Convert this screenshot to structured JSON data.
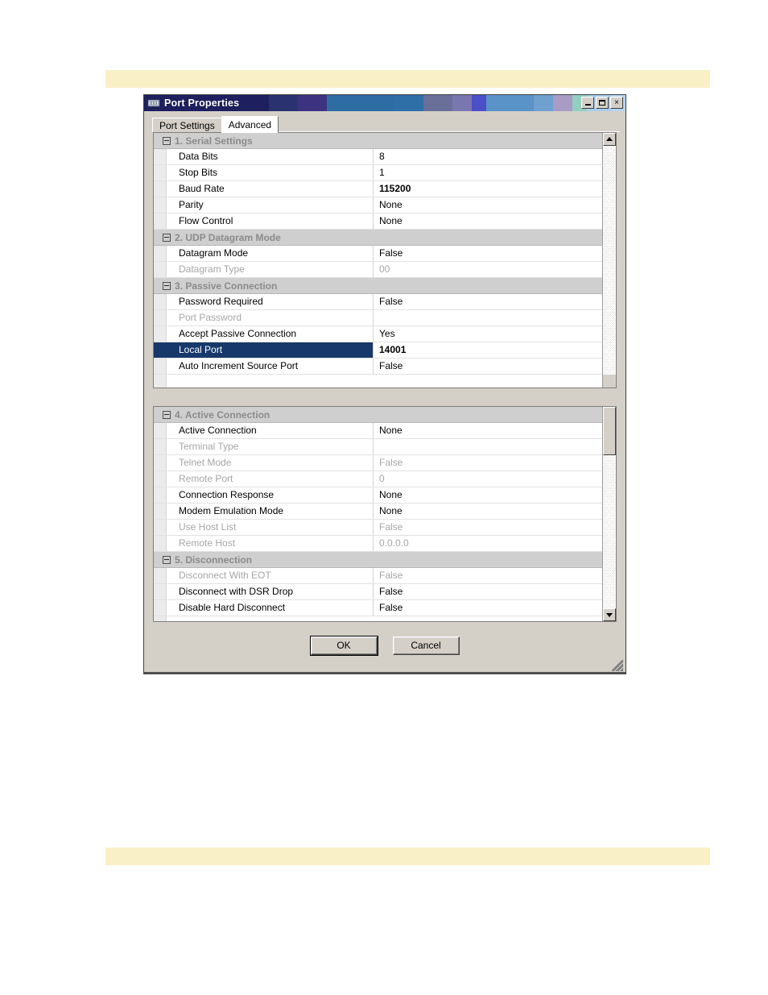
{
  "window": {
    "title": "Port Properties",
    "icon": "serial-port-icon",
    "titlebar_bands": [
      "#1d1f5e",
      "#2a3270",
      "#3d3280",
      "#2e6da4",
      "#2f6fa8",
      "#6a6f9a",
      "#7a77b0",
      "#4b4fc8",
      "#5a93c8",
      "#6fa0d0",
      "#a89cc4",
      "#93cfc0",
      "#a8cdee",
      "#b5d6f2"
    ],
    "controls": {
      "minimize": "minimize-button",
      "maximize": "maximize-button",
      "close": "×"
    }
  },
  "tabs": [
    {
      "label": "Port Settings",
      "selected": false
    },
    {
      "label": "Advanced",
      "selected": true
    }
  ],
  "panels": [
    {
      "name": "upper-grid",
      "scroll": {
        "thumb_visible": false,
        "up_arrow": true,
        "down_arrow": false
      },
      "rows": [
        {
          "type": "header",
          "label": "1. Serial Settings"
        },
        {
          "type": "prop",
          "name": "Data Bits",
          "value": "8",
          "disabled": false,
          "bold": false,
          "selected": false
        },
        {
          "type": "prop",
          "name": "Stop Bits",
          "value": "1",
          "disabled": false,
          "bold": false,
          "selected": false
        },
        {
          "type": "prop",
          "name": "Baud Rate",
          "value": "115200",
          "disabled": false,
          "bold": true,
          "selected": false
        },
        {
          "type": "prop",
          "name": "Parity",
          "value": "None",
          "disabled": false,
          "bold": false,
          "selected": false
        },
        {
          "type": "prop",
          "name": "Flow Control",
          "value": "None",
          "disabled": false,
          "bold": false,
          "selected": false
        },
        {
          "type": "header",
          "label": "2. UDP Datagram Mode"
        },
        {
          "type": "prop",
          "name": "Datagram Mode",
          "value": "False",
          "disabled": false,
          "bold": false,
          "selected": false
        },
        {
          "type": "prop",
          "name": "Datagram Type",
          "value": "00",
          "disabled": true,
          "bold": false,
          "selected": false
        },
        {
          "type": "header",
          "label": "3. Passive Connection"
        },
        {
          "type": "prop",
          "name": "Password Required",
          "value": "False",
          "disabled": false,
          "bold": false,
          "selected": false
        },
        {
          "type": "prop",
          "name": "Port Password",
          "value": "",
          "disabled": true,
          "bold": false,
          "selected": false
        },
        {
          "type": "prop",
          "name": "Accept Passive Connection",
          "value": "Yes",
          "disabled": false,
          "bold": false,
          "selected": false
        },
        {
          "type": "prop",
          "name": "Local Port",
          "value": "14001",
          "disabled": false,
          "bold": true,
          "selected": true
        },
        {
          "type": "prop",
          "name": "Auto Increment Source Port",
          "value": "False",
          "disabled": false,
          "bold": false,
          "selected": false
        }
      ]
    },
    {
      "name": "lower-grid",
      "scroll": {
        "thumb_visible": true,
        "up_arrow": false,
        "down_arrow": true
      },
      "rows": [
        {
          "type": "header",
          "label": "4. Active Connection"
        },
        {
          "type": "prop",
          "name": "Active Connection",
          "value": "None",
          "disabled": false,
          "bold": false,
          "selected": false
        },
        {
          "type": "prop",
          "name": "Terminal Type",
          "value": "",
          "disabled": true,
          "bold": false,
          "selected": false
        },
        {
          "type": "prop",
          "name": "Telnet Mode",
          "value": "False",
          "disabled": true,
          "bold": false,
          "selected": false
        },
        {
          "type": "prop",
          "name": "Remote Port",
          "value": "0",
          "disabled": true,
          "bold": false,
          "selected": false
        },
        {
          "type": "prop",
          "name": "Connection Response",
          "value": "None",
          "disabled": false,
          "bold": false,
          "selected": false
        },
        {
          "type": "prop",
          "name": "Modem Emulation Mode",
          "value": "None",
          "disabled": false,
          "bold": false,
          "selected": false
        },
        {
          "type": "prop",
          "name": "Use Host List",
          "value": "False",
          "disabled": true,
          "bold": false,
          "selected": false
        },
        {
          "type": "prop",
          "name": "Remote Host",
          "value": "0.0.0.0",
          "disabled": true,
          "bold": false,
          "selected": false
        },
        {
          "type": "header",
          "label": "5. Disconnection"
        },
        {
          "type": "prop",
          "name": "Disconnect With EOT",
          "value": "False",
          "disabled": true,
          "bold": false,
          "selected": false
        },
        {
          "type": "prop",
          "name": "Disconnect with DSR Drop",
          "value": "False",
          "disabled": false,
          "bold": false,
          "selected": false
        },
        {
          "type": "prop",
          "name": "Disable Hard Disconnect",
          "value": "False",
          "disabled": false,
          "bold": false,
          "selected": false
        }
      ]
    }
  ],
  "buttons": {
    "ok": "OK",
    "cancel": "Cancel"
  },
  "colors": {
    "selection": "#17386a",
    "dialog_face": "#d4d0c8",
    "header_face": "#cfcfcf",
    "disabled_text": "#a6a6a6",
    "band": "#faf0c8"
  }
}
